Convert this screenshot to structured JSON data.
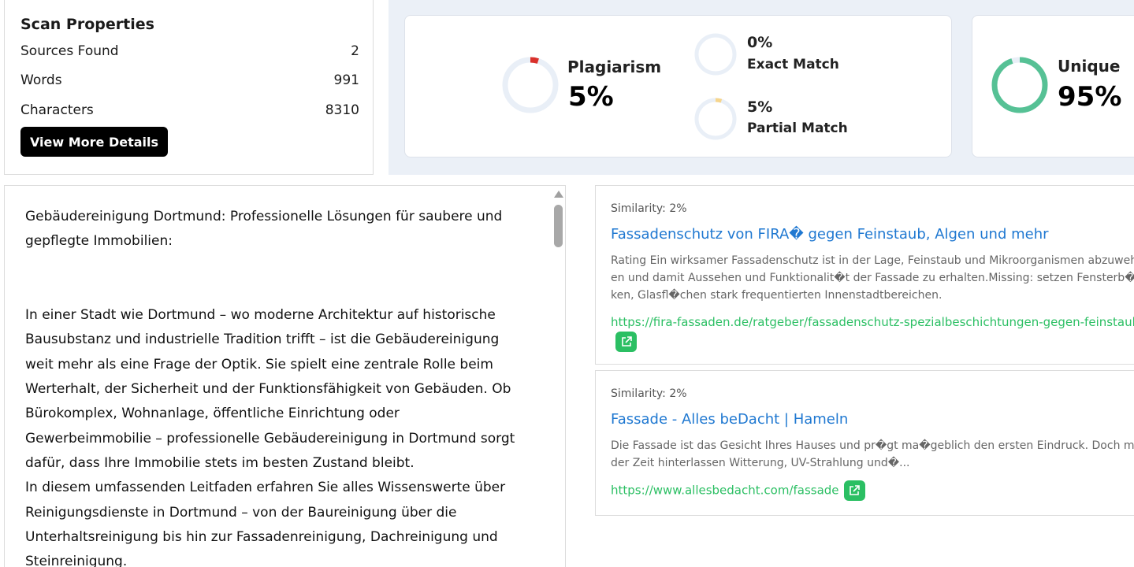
{
  "scan": {
    "title": "Scan Properties",
    "rows": [
      {
        "label": "Sources Found",
        "value": "2"
      },
      {
        "label": "Words",
        "value": "991"
      },
      {
        "label": "Characters",
        "value": "8310"
      }
    ],
    "button": "View More Details"
  },
  "stats": {
    "plagiarism": {
      "label": "Plagiarism",
      "value": "5%",
      "fraction": 0.05,
      "color": "#d9302b"
    },
    "exact": {
      "value": "0%",
      "label": "Exact Match",
      "fraction": 0.0
    },
    "partial": {
      "value": "5%",
      "label": "Partial Match",
      "fraction": 0.05,
      "color": "#f6d58c"
    },
    "unique": {
      "label": "Unique",
      "value": "95%",
      "fraction": 0.95,
      "color": "#56c195"
    },
    "track_color": "#e9eff7"
  },
  "text": {
    "content": "Gebäudereinigung Dortmund: Professionelle Lösungen für saubere und gepflegte Immobilien:\n\n\nIn einer Stadt wie Dortmund – wo moderne Architektur auf historische Bausubstanz und industrielle Tradition trifft – ist die Gebäudereinigung weit mehr als eine Frage der Optik. Sie spielt eine zentrale Rolle beim Werterhalt, der Sicherheit und der Funktionsfähigkeit von Gebäuden. Ob Bürokomplex, Wohnanlage, öffentliche Einrichtung oder Gewerbeimmobilie – professionelle Gebäudereinigung in Dortmund sorgt dafür, dass Ihre Immobilie stets im besten Zustand bleibt.\nIn diesem umfassenden Leitfaden erfahren Sie alles Wissenswerte über Reinigungsdienste in Dortmund – von der Baureinigung über die Unterhaltsreinigung bis hin zur Fassadenreinigung, Dachreinigung und Steinreinigung."
  },
  "sources": [
    {
      "similarity": "Similarity: 2%",
      "title": "Fassadenschutz von FIRA� gegen Feinstaub, Algen und mehr",
      "snippet": "Rating Ein wirksamer Fassadenschutz ist in der Lage, Feinstaub und Mikroorganismen abzuwehren und damit Aussehen und Funktionalit�t der Fassade zu erhalten.Missing: setzen Fensterb�nken, Glasfl�chen stark frequentierten Innenstadtbereichen.",
      "url": "https://fira-fassaden.de/ratgeber/fassadenschutz-spezialbeschichtungen-gegen-feinstaub"
    },
    {
      "similarity": "Similarity: 2%",
      "title": "Fassade - Alles beDacht | Hameln",
      "snippet": "Die Fassade ist das Gesicht Ihres Hauses und pr�gt ma�geblich den ersten Eindruck. Doch mit der Zeit hinterlassen Witterung, UV-Strahlung und�...",
      "url": "https://www.allesbedacht.com/fassade"
    }
  ]
}
